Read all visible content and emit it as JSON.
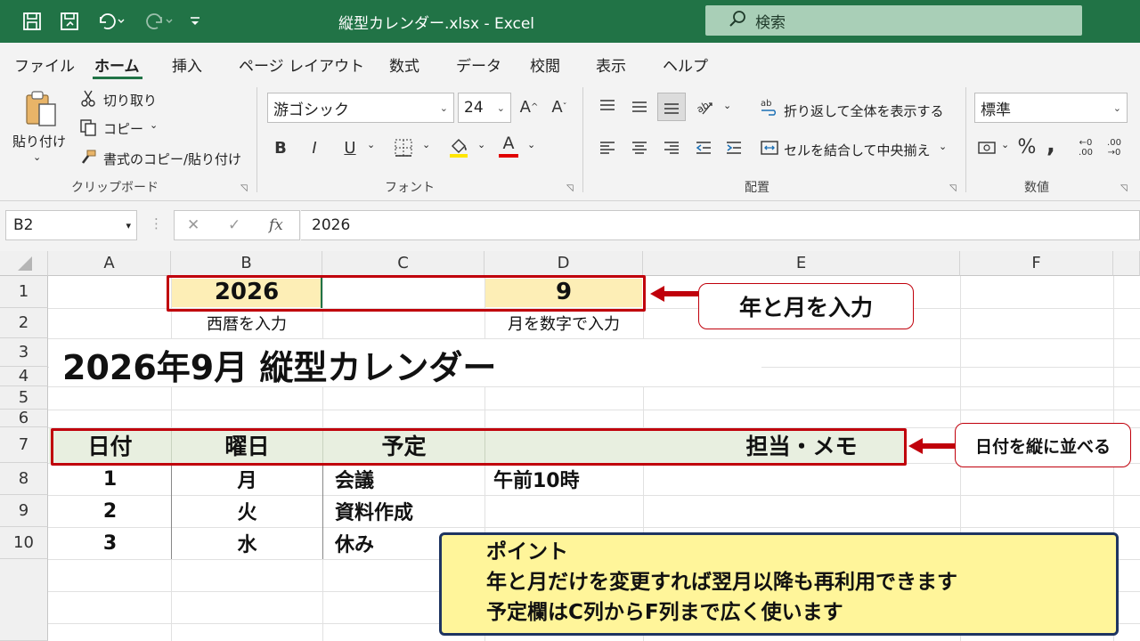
{
  "window": {
    "title": "縦型カレンダー.xlsx  -  Excel",
    "search_label": "検索"
  },
  "quick_access": {
    "icons": [
      "save-icon",
      "save-as-icon",
      "undo-icon",
      "redo-icon",
      "customize-icon"
    ]
  },
  "menu_tabs": [
    "ファイル",
    "ホーム",
    "挿入",
    "ページ レイアウト",
    "数式",
    "データ",
    "校閲",
    "表示",
    "ヘルプ"
  ],
  "active_tab": "ホーム",
  "ribbon": {
    "clipboard": {
      "paste": "貼り付け",
      "cut": "切り取り",
      "copy": "コピー",
      "format_painter": "書式のコピー/貼り付け",
      "group_label": "クリップボード"
    },
    "font": {
      "font_name": "游ゴシック",
      "font_size": "24",
      "bold": "B",
      "italic": "I",
      "underline": "U",
      "font_color_letter": "A",
      "group_label": "フォント"
    },
    "alignment": {
      "wrap_text": "折り返して全体を表示する",
      "merge_center": "セルを結合して中央揃え",
      "group_label": "配置"
    },
    "number": {
      "format": "標準",
      "percent": "%",
      "comma": ",",
      "increase_decimal": "←0 .00",
      "decrease_decimal": ".00 →0",
      "group_label": "数値"
    },
    "colors": {
      "fill_highlight": "#ffe600",
      "font_red": "#e00000"
    }
  },
  "formula_bar": {
    "name_box": "B2",
    "cancel": "✕",
    "enter": "✓",
    "fx": "fx",
    "value": "2026"
  },
  "sheet": {
    "columns": [
      "A",
      "B",
      "C",
      "D",
      "E",
      "F"
    ],
    "rows": [
      "1",
      "2",
      "3",
      "4",
      "5",
      "6",
      "7",
      "8",
      "9",
      "10"
    ],
    "year_value": "2026",
    "month_value": "9",
    "year_note": "西暦を入力",
    "month_note": "月を数字で入力",
    "calendar_title": "2026年9月 縦型カレンダー",
    "table_headers": [
      "日付",
      "曜日",
      "予定",
      "担当・メモ"
    ],
    "table_rows": [
      {
        "date": "1",
        "weekday": "月",
        "plan": "会議",
        "memo": "午前10時"
      },
      {
        "date": "2",
        "weekday": "火",
        "plan": "資料作成",
        "memo": ""
      },
      {
        "date": "3",
        "weekday": "水",
        "plan": "休み",
        "memo": ""
      }
    ]
  },
  "annotations": {
    "year_month_callout": "年と月を入力",
    "date_vertical_callout": "日付を縦に並べる",
    "point_title": "ポイント",
    "point_line1": "年と月だけを変更すれば翌月以降も再利用できます",
    "point_line2": "予定欄はC列からF列まで広く使います",
    "accent_color": "#c0000b",
    "point_bg": "#fff59a",
    "point_border": "#1e3461"
  }
}
